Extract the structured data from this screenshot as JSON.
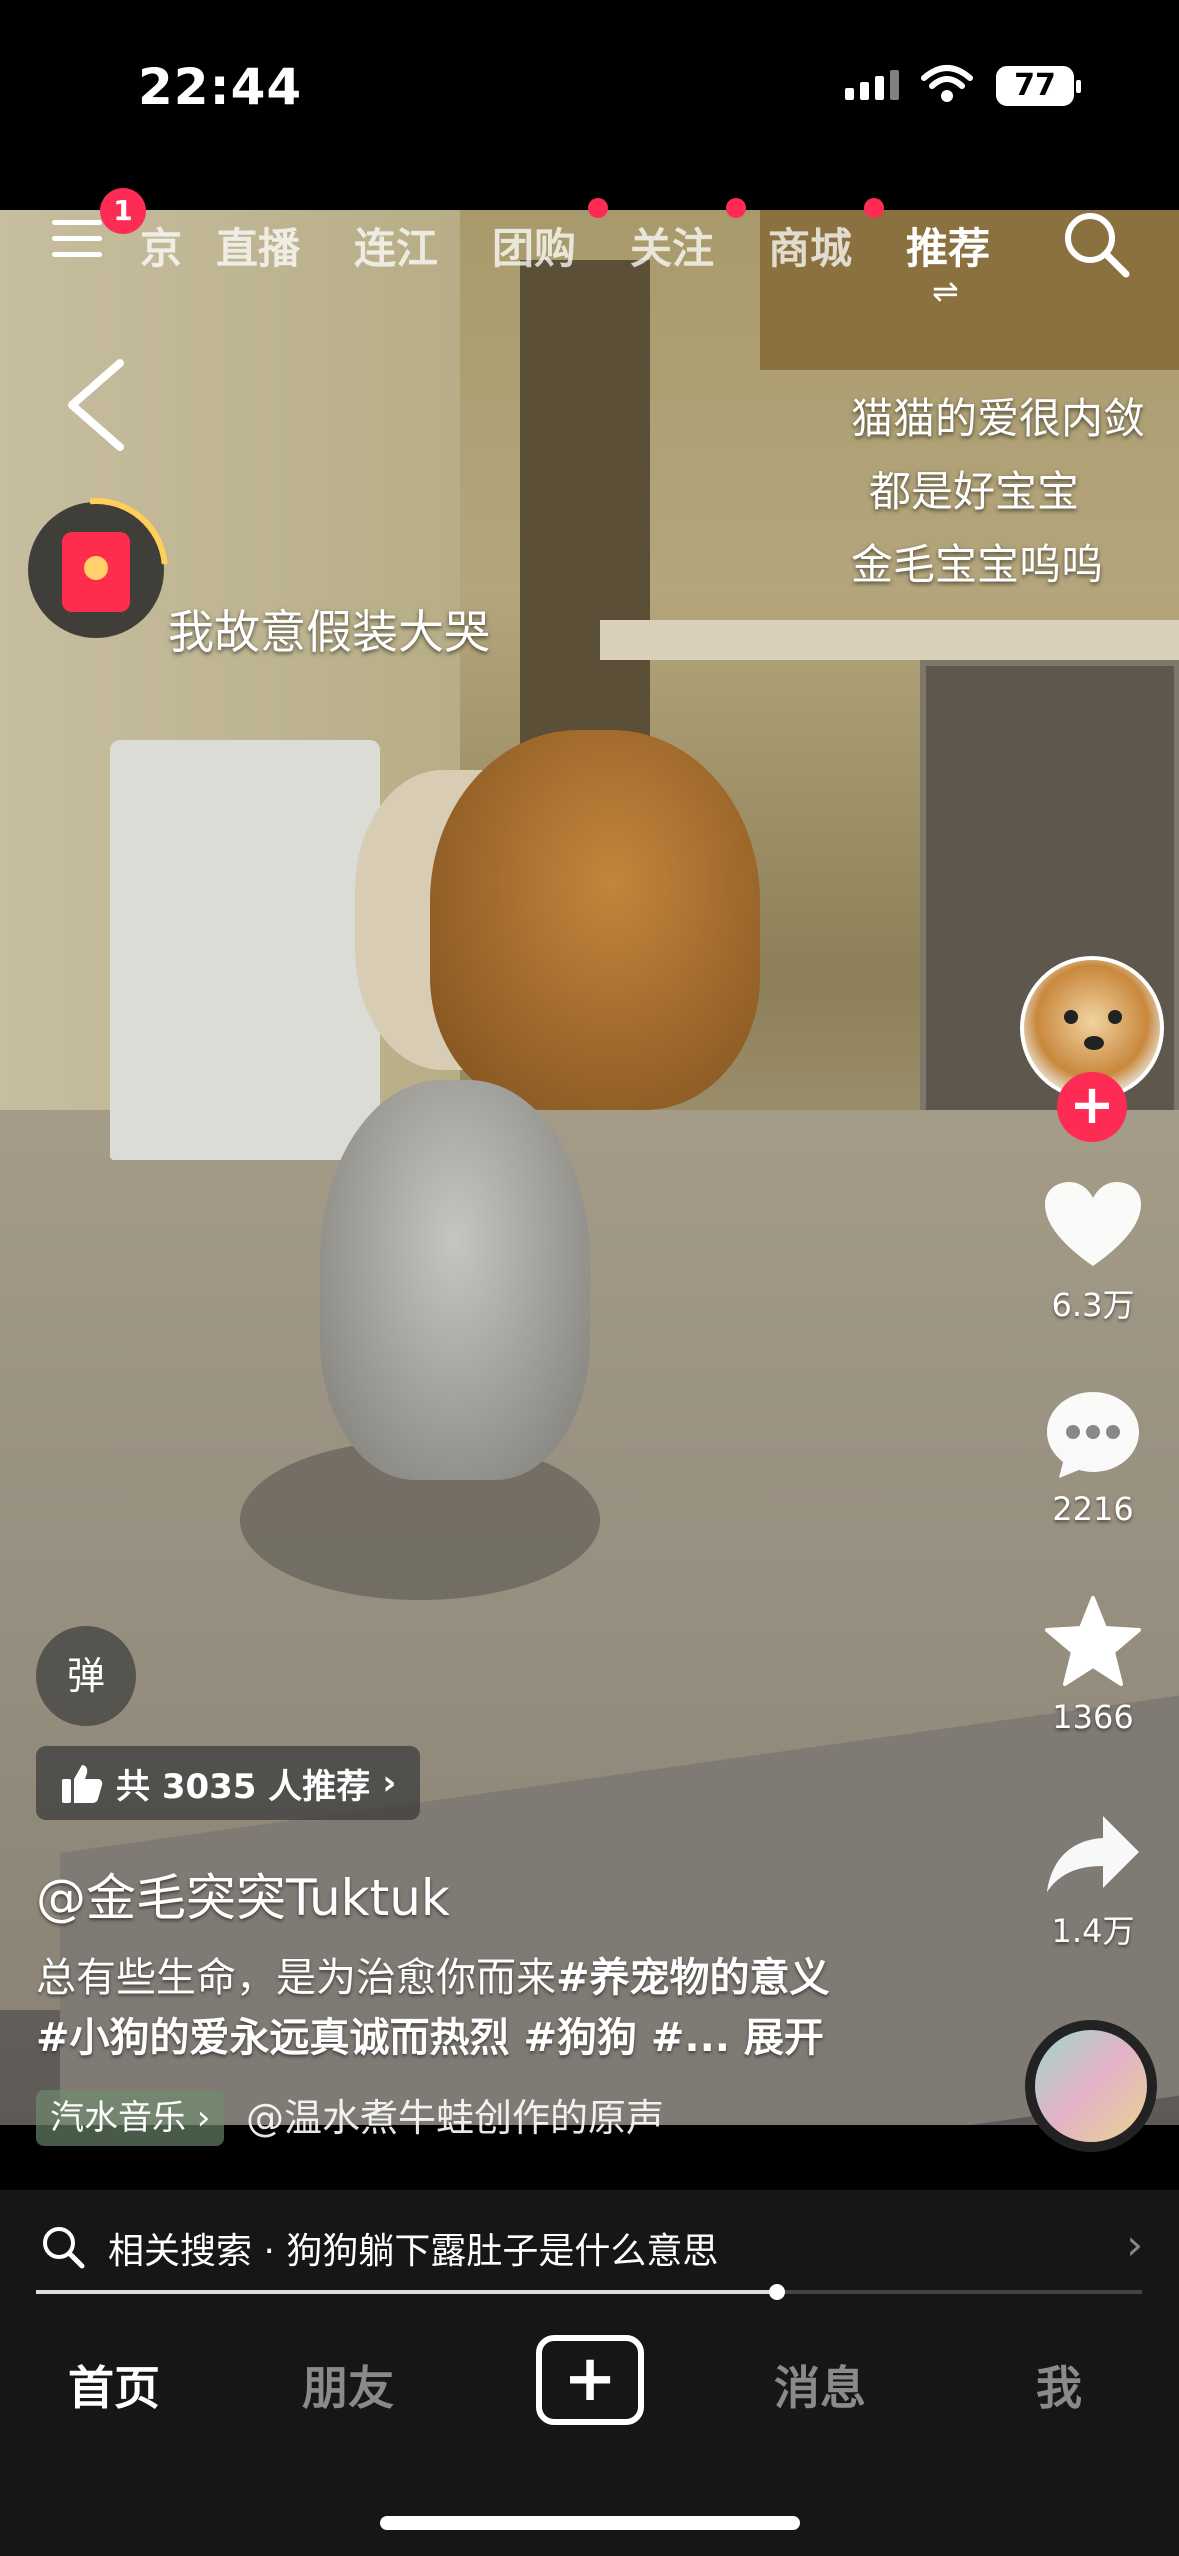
{
  "status_bar": {
    "time": "22:44",
    "battery": "77"
  },
  "top_nav": {
    "menu_badge": "1",
    "tabs": [
      {
        "label": "京",
        "active": false
      },
      {
        "label": "直播",
        "active": false
      },
      {
        "label": "连江",
        "active": false
      },
      {
        "label": "团购",
        "active": false
      },
      {
        "label": "关注",
        "active": false
      },
      {
        "label": "商城",
        "active": false
      },
      {
        "label": "推荐",
        "active": true
      }
    ],
    "swap_glyph": "⇌"
  },
  "video": {
    "overlay_caption": "我故意假装大哭",
    "right_captions": [
      "猫猫的爱很内敛",
      "都是好宝宝",
      "金毛宝宝呜呜"
    ]
  },
  "actions": {
    "likes": "6.3万",
    "comments": "2216",
    "favorites": "1366",
    "shares": "1.4万"
  },
  "info": {
    "danmu_label": "弹",
    "recommend_text": "共 3035 人推荐",
    "author": "@金毛突突Tuktuk",
    "desc_line1_plain": "总有些生命，是为治愈你而来",
    "desc_line1_tag": "#养宠物的意义",
    "desc_line2": "#小狗的爱永远真诚而热烈 #狗狗 #...",
    "expand": "展开",
    "music_tag": "汽水音乐 ›",
    "music_text": "@温水煮牛蛙创作的原声"
  },
  "related": {
    "text": "相关搜索 · 狗狗躺下露肚子是什么意思",
    "progress": 0.67
  },
  "tab_bar": {
    "home": "首页",
    "friends": "朋友",
    "create": "+",
    "messages": "消息",
    "me": "我"
  },
  "colors": {
    "accent": "#fe2c55",
    "bar_bg": "#161616"
  }
}
